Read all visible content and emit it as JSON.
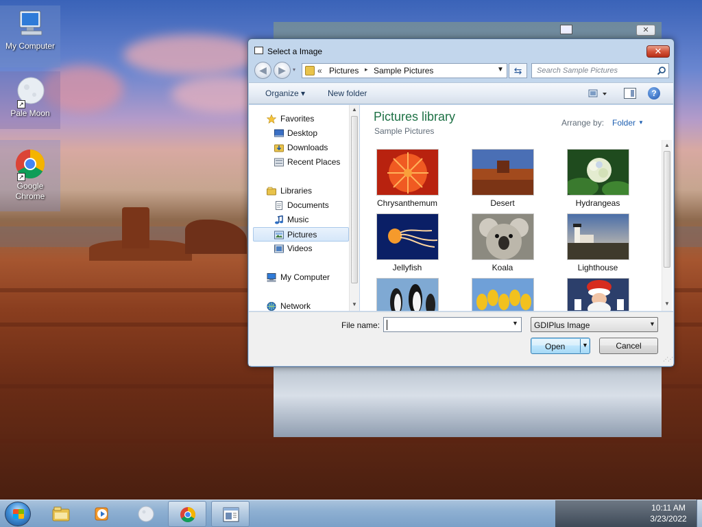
{
  "desktop": {
    "icons": [
      {
        "label": "My Computer",
        "icon": "computer-icon"
      },
      {
        "label": "Pale Moon",
        "icon": "pale-moon-icon"
      },
      {
        "label": "Google Chrome",
        "icon": "chrome-icon"
      }
    ]
  },
  "dialog": {
    "title": "Select a Image",
    "close_glyph": "✕",
    "address": {
      "overflow": "«",
      "crumbs": [
        "Pictures",
        "Sample Pictures"
      ],
      "separator": "▸"
    },
    "search_placeholder": "Search Sample Pictures",
    "toolbar": {
      "organize": "Organize ▾",
      "new_folder": "New folder",
      "help": "?"
    },
    "nav": {
      "items": [
        {
          "label": "Favorites",
          "icon": "star-icon"
        },
        {
          "label": "Desktop",
          "icon": "desktop-icon"
        },
        {
          "label": "Downloads",
          "icon": "downloads-icon"
        },
        {
          "label": "Recent Places",
          "icon": "recent-places-icon"
        },
        {
          "label": "Libraries",
          "icon": "libraries-icon"
        },
        {
          "label": "Documents",
          "icon": "documents-icon"
        },
        {
          "label": "Music",
          "icon": "music-icon"
        },
        {
          "label": "Pictures",
          "icon": "pictures-icon"
        },
        {
          "label": "Videos",
          "icon": "videos-icon"
        },
        {
          "label": "My Computer",
          "icon": "computer-icon"
        },
        {
          "label": "Network",
          "icon": "network-icon"
        }
      ],
      "selected": "Pictures"
    },
    "content": {
      "library_title": "Pictures library",
      "library_subtitle": "Sample Pictures",
      "arrange_label": "Arrange by:",
      "arrange_value": "Folder",
      "files": [
        "Chrysanthemum",
        "Desert",
        "Hydrangeas",
        "Jellyfish",
        "Koala",
        "Lighthouse",
        "Penguins",
        "Tulips",
        "Santa"
      ]
    },
    "bottom": {
      "filename_label": "File name:",
      "filename_value": "",
      "filetype_value": "GDIPlus Image",
      "open_label": "Open",
      "cancel_label": "Cancel"
    }
  },
  "taskbar": {
    "items": [
      "explorer-icon",
      "media-player-icon",
      "pale-moon-icon",
      "chrome-icon",
      "window-app-icon"
    ],
    "clock_time": "10:11 AM",
    "clock_date": "3/23/2022"
  }
}
